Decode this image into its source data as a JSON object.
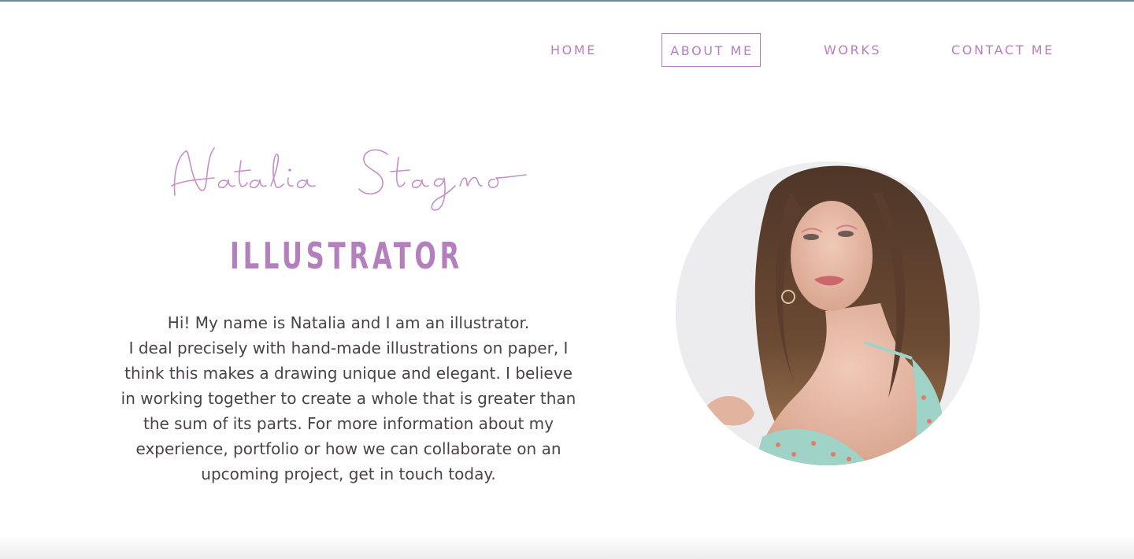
{
  "nav": {
    "items": [
      {
        "label": "HOME"
      },
      {
        "label": "ABOUT ME",
        "active": true
      },
      {
        "label": "WORKS"
      },
      {
        "label": "CONTACT ME"
      }
    ]
  },
  "hero": {
    "signature": "Natalia Stagno",
    "role": "ILLUSTRATOR",
    "bio_lines": [
      "Hi! My name is Natalia and I am an illustrator.",
      "I deal precisely with hand-made illustrations on paper, I",
      "think this makes a drawing unique and elegant. I believe",
      "in working together to create a whole that is greater than",
      "the sum of its parts. For more information about my",
      "experience, portfolio or how we can collaborate on an",
      "upcoming project, get in touch today."
    ]
  },
  "colors": {
    "accent": "#b47fbd",
    "text": "#4a4248",
    "top_rule": "#6f8794"
  }
}
